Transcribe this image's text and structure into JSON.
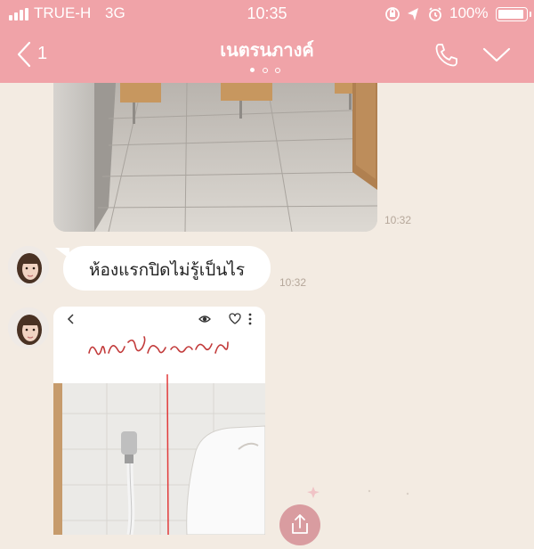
{
  "status_bar": {
    "carrier": "TRUE-H",
    "network": "3G",
    "time": "10:35",
    "battery": "100%",
    "battery_level": 1.0,
    "icons": [
      "screen-rotation-lock-icon",
      "location-arrow-icon",
      "alarm-clock-icon"
    ]
  },
  "header": {
    "back_count": "1",
    "title": "เนตรนภางค์",
    "page_dots": 3,
    "active_dot": 0,
    "actions": [
      "phone-icon",
      "chevron-down-icon"
    ]
  },
  "messages": [
    {
      "type": "image",
      "content": "restroom floor photo",
      "time": "10:32"
    },
    {
      "type": "text",
      "text": "ห้องแรกปิดไม่รู้เป็นไร",
      "time": "10:32"
    },
    {
      "type": "image",
      "content": "screenshot of a toilet photo with a handwritten note",
      "handwritten_note": "มีน้ำซึม ออกมา"
    }
  ],
  "colors": {
    "header": "#f0a3a8",
    "background": "#f3ebe2",
    "bubble": "#ffffff",
    "timestamp": "#b5a79a",
    "share_button": "#d99ca0"
  }
}
